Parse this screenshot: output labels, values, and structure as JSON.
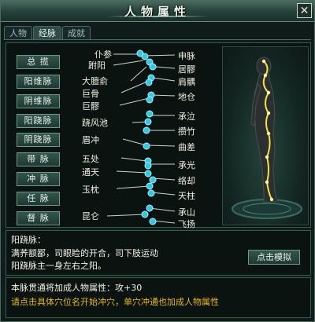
{
  "window": {
    "title": "人物属性",
    "close": "✕"
  },
  "tabs": [
    "人物",
    "经脉",
    "成就"
  ],
  "meridian_buttons": [
    "总 揽",
    "阳维脉",
    "阴维脉",
    "阳跷脉",
    "阴跷脉",
    "带 脉",
    "冲 脉",
    "任 脉",
    "督 脉"
  ],
  "acupoints_left": [
    "仆参",
    "跗阳",
    "大膻俞",
    "巨骨",
    "巨髎",
    "跷风池",
    "眉冲",
    "五处",
    "通天",
    "玉枕",
    "昆仑"
  ],
  "acupoints_right": [
    "申脉",
    "居髎",
    "肩髃",
    "地仓",
    "承泣",
    "攒竹",
    "曲差",
    "承光",
    "络却",
    "天柱",
    "承山",
    "飞扬"
  ],
  "description": {
    "title": "阳跷脉：",
    "line1": "满荞额鄙，司眼睑的开合，司下肢运动",
    "line2": "阳跷脉主一身左右之阳。"
  },
  "simulate_button": "点击模拟",
  "bonus_text": "本脉贯通将加成人物属性：攻+30",
  "hint_text": "请点击具体穴位名开始冲穴，单穴冲通也加成人物属性",
  "colors": {
    "node": "#35c6e0",
    "hint": "#e7b91a",
    "glow": "#f3e24a"
  }
}
